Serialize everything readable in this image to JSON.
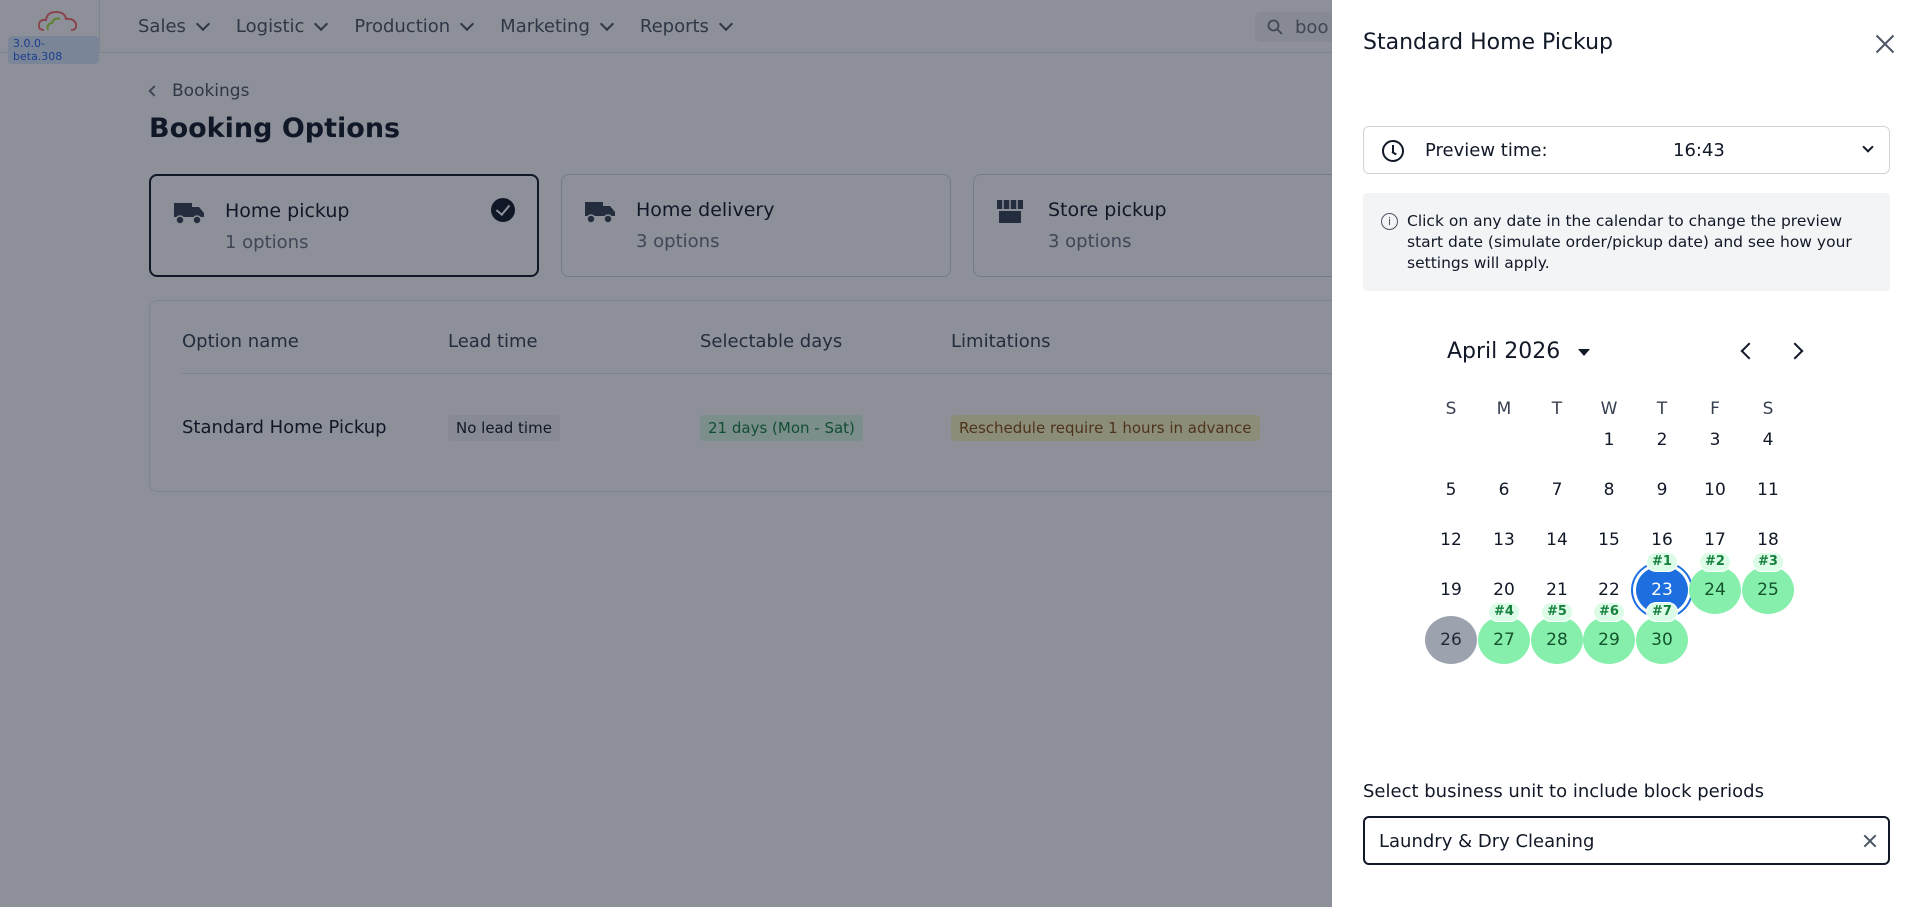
{
  "app": {
    "version": "3.0.0-beta.308",
    "nav": [
      {
        "label": "Sales"
      },
      {
        "label": "Logistic"
      },
      {
        "label": "Production"
      },
      {
        "label": "Marketing"
      },
      {
        "label": "Reports"
      }
    ],
    "search_value": "boo"
  },
  "page": {
    "breadcrumb": "Bookings",
    "title": "Booking Options",
    "cards": [
      {
        "title": "Home pickup",
        "sub": "1 options",
        "selected": true,
        "icon": "truck-icon"
      },
      {
        "title": "Home delivery",
        "sub": "3 options",
        "selected": false,
        "icon": "truck-icon"
      },
      {
        "title": "Store pickup",
        "sub": "3 options",
        "selected": false,
        "icon": "store-icon"
      }
    ],
    "table": {
      "headers": [
        "Option name",
        "Lead time",
        "Selectable days",
        "Limitations"
      ],
      "rows": [
        {
          "name": "Standard Home Pickup",
          "lead": "No lead time",
          "days": "21 days (Mon - Sat)",
          "limit": "Reschedule require 1 hours in advance"
        }
      ]
    }
  },
  "drawer": {
    "title": "Standard Home Pickup",
    "preview_label": "Preview time:",
    "preview_value": "16:43",
    "info": "Click on any date in the calendar to change the preview start date (simulate order/pickup date) and see how your settings will apply.",
    "calendar": {
      "month": "April 2026",
      "weekdays": [
        "S",
        "M",
        "T",
        "W",
        "T",
        "F",
        "S"
      ],
      "first_weekday_index": 3,
      "days_in_month": 30,
      "today": 23,
      "past_selected": 26,
      "available": [
        {
          "day": 23,
          "badge": "#1"
        },
        {
          "day": 24,
          "badge": "#2"
        },
        {
          "day": 25,
          "badge": "#3"
        },
        {
          "day": 27,
          "badge": "#4"
        },
        {
          "day": 28,
          "badge": "#5"
        },
        {
          "day": 29,
          "badge": "#6"
        },
        {
          "day": 30,
          "badge": "#7"
        }
      ]
    },
    "business_unit_label": "Select business unit to include block periods",
    "business_unit_value": "Laundry & Dry Cleaning"
  }
}
